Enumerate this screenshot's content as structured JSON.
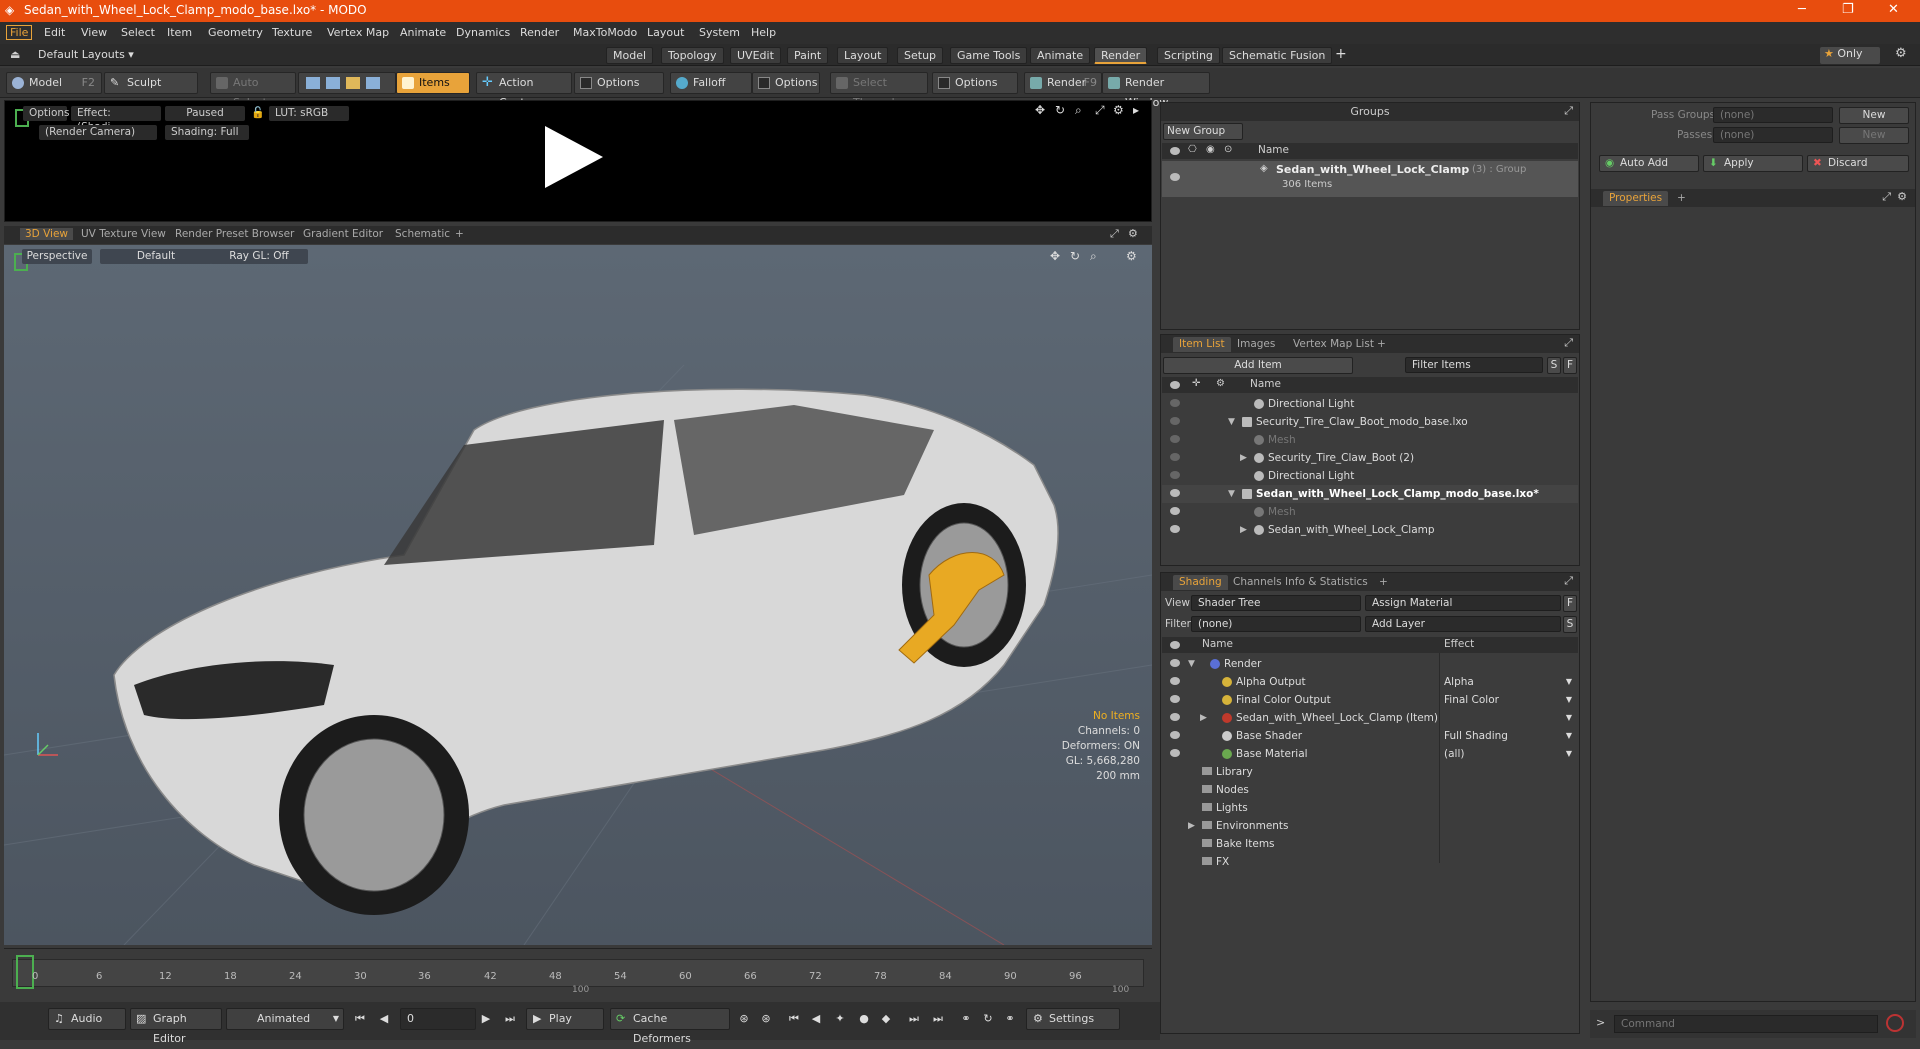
{
  "window": {
    "title": "Sedan_with_Wheel_Lock_Clamp_modo_base.lxo* - MODO",
    "minimize": "─",
    "restore": "❐",
    "close": "✕"
  },
  "menu": {
    "items": [
      "File",
      "Edit",
      "View",
      "Select",
      "Item",
      "Geometry",
      "Texture",
      "Vertex Map",
      "Animate",
      "Dynamics",
      "Render",
      "MaxToModo",
      "Layout",
      "System",
      "Help"
    ]
  },
  "layoutbar": {
    "layout_selector": "Default Layouts ▾",
    "tabs": [
      "Model",
      "Topology",
      "UVEdit",
      "Paint",
      "Layout",
      "Setup",
      "Game Tools",
      "Animate",
      "Render",
      "Scripting",
      "Schematic Fusion"
    ],
    "active_tab": "Render",
    "add": "+",
    "only_label": "Only"
  },
  "toolbar": {
    "model": "Model",
    "model_key": "F2",
    "sculpt": "Sculpt",
    "auto_select": "Auto Select",
    "items": "Items",
    "action_center": "Action Center",
    "options1": "Options",
    "falloff": "Falloff",
    "options2": "Options",
    "select_through": "Select Through",
    "options3": "Options",
    "render": "Render",
    "render_key": "F9",
    "render_window": "Render Window"
  },
  "render_preview": {
    "options": "Options",
    "effect": "Effect: (Shadi...",
    "paused": "Paused",
    "lut": "LUT: sRGB",
    "camera": "(Render Camera)",
    "shading": "Shading: Full"
  },
  "viewport_tabs": {
    "tabs": [
      "3D View",
      "UV Texture View",
      "Render Preset Browser",
      "Gradient Editor",
      "Schematic"
    ],
    "active": "3D View",
    "add": "+"
  },
  "viewport": {
    "perspective": "Perspective",
    "default": "Default",
    "raygl": "Ray GL: Off",
    "stats": {
      "no_items": "No Items",
      "channels": "Channels: 0",
      "deformers": "Deformers: ON",
      "gl": "GL: 5,668,280",
      "scale": "200 mm"
    }
  },
  "timeline": {
    "ticks": [
      "0",
      "6",
      "12",
      "18",
      "24",
      "30",
      "36",
      "42",
      "48",
      "54",
      "60",
      "66",
      "72",
      "78",
      "84",
      "90",
      "96"
    ],
    "mid": "100",
    "end": "100"
  },
  "bottombar": {
    "audio": "Audio",
    "graph_editor": "Graph Editor",
    "animated": "Animated",
    "frame": "0",
    "play": "Play",
    "cache_deformers": "Cache Deformers",
    "settings": "Settings"
  },
  "groups": {
    "title": "Groups",
    "new_group": "New Group",
    "col_name": "Name",
    "item_name": "Sedan_with_Wheel_Lock_Clamp",
    "item_suffix": "(3) : Group",
    "item_count": "306 Items"
  },
  "item_list": {
    "tabs": [
      "Item List",
      "Images",
      "Vertex Map List"
    ],
    "add": "+",
    "add_item": "Add Item",
    "filter": "Filter Items",
    "col_name": "Name",
    "rows": [
      {
        "label": "Directional Light",
        "indent": 2,
        "bold": false,
        "dim": false,
        "eye": false,
        "tri": ""
      },
      {
        "label": "Security_Tire_Claw_Boot_modo_base.lxo",
        "indent": 1,
        "bold": false,
        "dim": false,
        "eye": false,
        "tri": "▼"
      },
      {
        "label": "Mesh",
        "indent": 2,
        "bold": false,
        "dim": true,
        "eye": false,
        "tri": ""
      },
      {
        "label": "Security_Tire_Claw_Boot (2)",
        "indent": 2,
        "bold": false,
        "dim": false,
        "eye": false,
        "tri": "▶"
      },
      {
        "label": "Directional Light",
        "indent": 2,
        "bold": false,
        "dim": false,
        "eye": false,
        "tri": ""
      },
      {
        "label": "Sedan_with_Wheel_Lock_Clamp_modo_base.lxo*",
        "indent": 1,
        "bold": true,
        "dim": false,
        "eye": true,
        "tri": "▼"
      },
      {
        "label": "Mesh",
        "indent": 2,
        "bold": false,
        "dim": true,
        "eye": true,
        "tri": ""
      },
      {
        "label": "Sedan_with_Wheel_Lock_Clamp",
        "indent": 2,
        "bold": false,
        "dim": false,
        "eye": true,
        "tri": "▶"
      }
    ]
  },
  "shading": {
    "tabs": [
      "Shading",
      "Channels",
      "Info & Statistics"
    ],
    "add": "+",
    "view_label": "View",
    "view_value": "Shader Tree",
    "assign_material": "Assign Material",
    "filter_label": "Filter",
    "filter_value": "(none)",
    "add_layer": "Add Layer",
    "col_name": "Name",
    "col_effect": "Effect",
    "rows": [
      {
        "label": "Render",
        "effect": "",
        "indent": 0,
        "tri": "▼",
        "icon": "#5a6fd6",
        "eye": true
      },
      {
        "label": "Alpha Output",
        "effect": "Alpha",
        "indent": 1,
        "tri": "",
        "icon": "#d6b33a",
        "eye": true
      },
      {
        "label": "Final Color Output",
        "effect": "Final Color",
        "indent": 1,
        "tri": "",
        "icon": "#d6b33a",
        "eye": true
      },
      {
        "label": "Sedan_with_Wheel_Lock_Clamp (Item)",
        "effect": "",
        "indent": 1,
        "tri": "▶",
        "icon": "#c0392b",
        "eye": true
      },
      {
        "label": "Base Shader",
        "effect": "Full Shading",
        "indent": 1,
        "tri": "",
        "icon": "#cccccc",
        "eye": true
      },
      {
        "label": "Base Material",
        "effect": "(all)",
        "indent": 1,
        "tri": "",
        "icon": "#6aa84f",
        "eye": true
      },
      {
        "label": "Library",
        "effect": "",
        "indent": 0,
        "tri": "",
        "icon": "",
        "eye": false
      },
      {
        "label": "Nodes",
        "effect": "",
        "indent": 0,
        "tri": "",
        "icon": "",
        "eye": false
      },
      {
        "label": "Lights",
        "effect": "",
        "indent": 0,
        "tri": "",
        "icon": "",
        "eye": false
      },
      {
        "label": "Environments",
        "effect": "",
        "indent": 0,
        "tri": "▶",
        "icon": "",
        "eye": false
      },
      {
        "label": "Bake Items",
        "effect": "",
        "indent": 0,
        "tri": "",
        "icon": "",
        "eye": false
      },
      {
        "label": "FX",
        "effect": "",
        "indent": 0,
        "tri": "",
        "icon": "",
        "eye": false
      }
    ]
  },
  "pass_panel": {
    "pass_groups": "Pass Groups",
    "pass_groups_value": "(none)",
    "new1": "New",
    "passes": "Passes",
    "passes_value": "(none)",
    "new2": "New",
    "auto_add": "Auto Add",
    "apply": "Apply",
    "discard": "Discard",
    "properties": "Properties",
    "add": "+"
  },
  "command": {
    "placeholder": "Command"
  },
  "colors": {
    "accent": "#e8a33a",
    "titlebar": "#e84d0e"
  }
}
